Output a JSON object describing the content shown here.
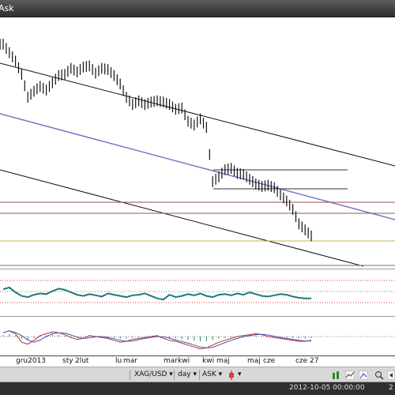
{
  "window": {
    "title": "Ask"
  },
  "chart_data": [
    {
      "type": "line",
      "title": "",
      "series": [
        {
          "values": [
            34.8,
            34.1,
            33.4,
            32.3,
            30.4,
            30.9,
            31.3,
            31.0,
            31.6,
            32.2,
            32.3,
            32.8,
            32.5,
            32.9,
            33.0,
            32.4,
            32.8,
            32.7,
            32.2,
            31.5,
            30.4,
            29.8,
            30.1,
            29.8,
            30.0,
            30.1,
            30.0,
            29.8,
            29.4,
            29.5,
            28.4,
            28.1,
            28.6,
            27.9,
            23.4,
            23.8,
            24.4,
            24.5,
            24.1,
            24.0,
            23.6,
            23.2,
            23.0,
            23.1,
            22.9,
            22.3,
            21.8,
            21.1,
            19.9,
            19.4,
            18.9
          ]
        }
      ],
      "support_resistance_levels": [
        25.1,
        23.5,
        22.0,
        21.2,
        19.4
      ]
    },
    {
      "type": "line",
      "series": [
        {
          "values": [
            55,
            58,
            50,
            44,
            42,
            46,
            48,
            47,
            52,
            56,
            54,
            50,
            46,
            44,
            47,
            45,
            43,
            48,
            46,
            44,
            42,
            45,
            46,
            48,
            44,
            40,
            38,
            46,
            42,
            44,
            47,
            45,
            48,
            44,
            42,
            46,
            47,
            45,
            48,
            46,
            50,
            47,
            44,
            43,
            45,
            47,
            46,
            43,
            41,
            40,
            40
          ]
        }
      ]
    },
    {
      "type": "bar",
      "series": [
        {
          "values": [
            0.4,
            0.6,
            0.3,
            -0.6,
            -0.8,
            -0.4,
            0.1,
            0.3,
            0.5,
            0.4,
            0.2,
            -0.1,
            -0.3,
            -0.2,
            0.1,
            0.0,
            -0.1,
            -0.2,
            -0.4,
            -0.6,
            -0.5,
            -0.3,
            -0.2,
            -0.1,
            0.0,
            0.1,
            -0.2,
            -0.4,
            -0.5,
            -0.7,
            -0.9,
            -1.1,
            -1.3,
            -1.2,
            -0.9,
            -0.6,
            -0.4,
            -0.2,
            0.0,
            0.1,
            0.2,
            0.3,
            0.2,
            0.0,
            -0.1,
            -0.2,
            -0.3,
            -0.4,
            -0.5,
            -0.5,
            -0.4
          ]
        }
      ]
    }
  ],
  "xaxis": {
    "labels": [
      "gru2013",
      "sty",
      "2lut",
      "lu",
      "mar",
      "mar",
      "kwi",
      "kwi",
      "maj",
      "maj",
      "cze",
      "cze",
      "27"
    ]
  },
  "toolbar": {
    "symbol": "XAG/USD",
    "period": "day",
    "price_type": "ASK"
  },
  "status": {
    "datetime": "2012-10-05 00:00:00",
    "extra": "2"
  },
  "icons": [
    "dropdown-arrow-icon",
    "candle-type-icon",
    "bar-type-icon",
    "line-type-icon",
    "zoom-icon"
  ]
}
